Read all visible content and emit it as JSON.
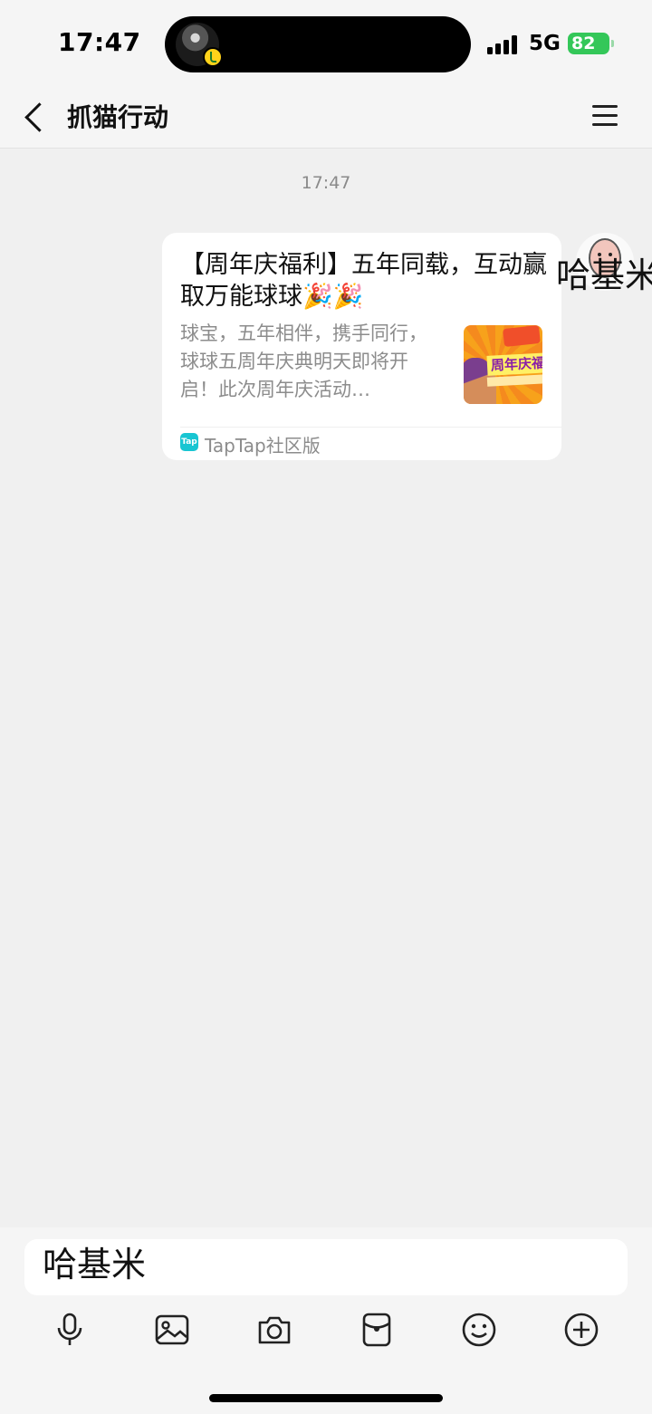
{
  "status_bar": {
    "time": "17:47",
    "network": "5G",
    "battery": "82"
  },
  "header": {
    "title": "抓猫行动"
  },
  "chat": {
    "timestamp": "17:47",
    "message": {
      "title": "【周年庆福利】五年同载，互动赢取万能球球🎉🎉",
      "description": "球宝，五年相伴，携手同行，球球五周年庆典明天即将开启！此次周年庆活动…",
      "thumbnail_text": "周年庆福",
      "source_label": "TapTap社区版",
      "source_icon_text": "Tap"
    },
    "sender": {
      "name_overlay": "哈基米"
    }
  },
  "composer": {
    "input_value": "哈基米"
  },
  "icons": {
    "back": "back-chevron-icon",
    "menu": "hamburger-menu-icon",
    "voice": "microphone-icon",
    "photo": "image-icon",
    "camera": "camera-icon",
    "red_packet": "red-packet-icon",
    "emoji": "emoji-icon",
    "more": "plus-icon"
  }
}
